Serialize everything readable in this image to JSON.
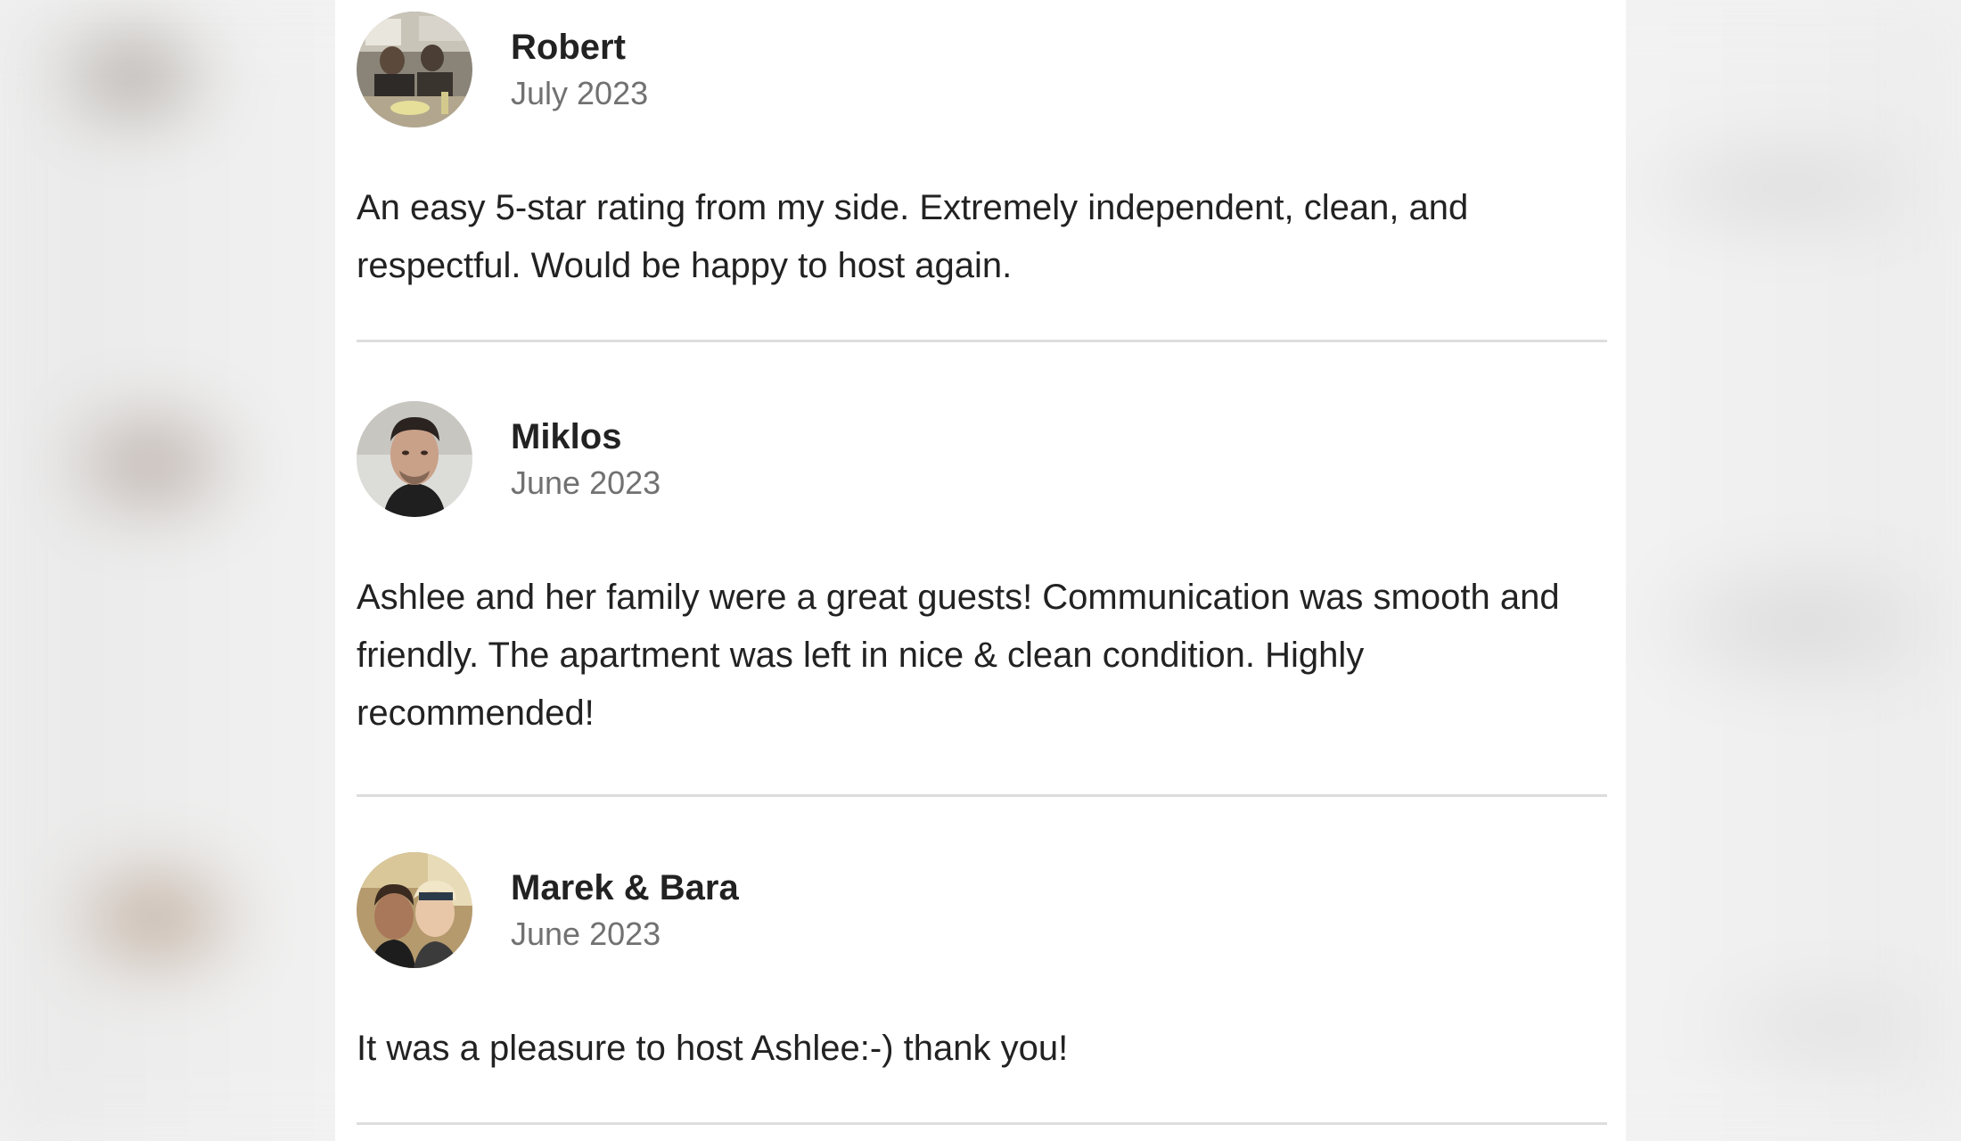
{
  "reviews": [
    {
      "name": "Robert",
      "date": "July 2023",
      "text": "An easy 5-star rating from my side. Extremely independent, clean, and respectful. Would be happy to host again."
    },
    {
      "name": "Miklos",
      "date": "June 2023",
      "text": "Ashlee and her family were a great guests! Communication was smooth and friendly. The apartment was left in nice & clean condition. Highly recommended!"
    },
    {
      "name": "Marek & Bara",
      "date": "June 2023",
      "text": "It was a pleasure to host Ashlee:-) thank you!"
    }
  ]
}
